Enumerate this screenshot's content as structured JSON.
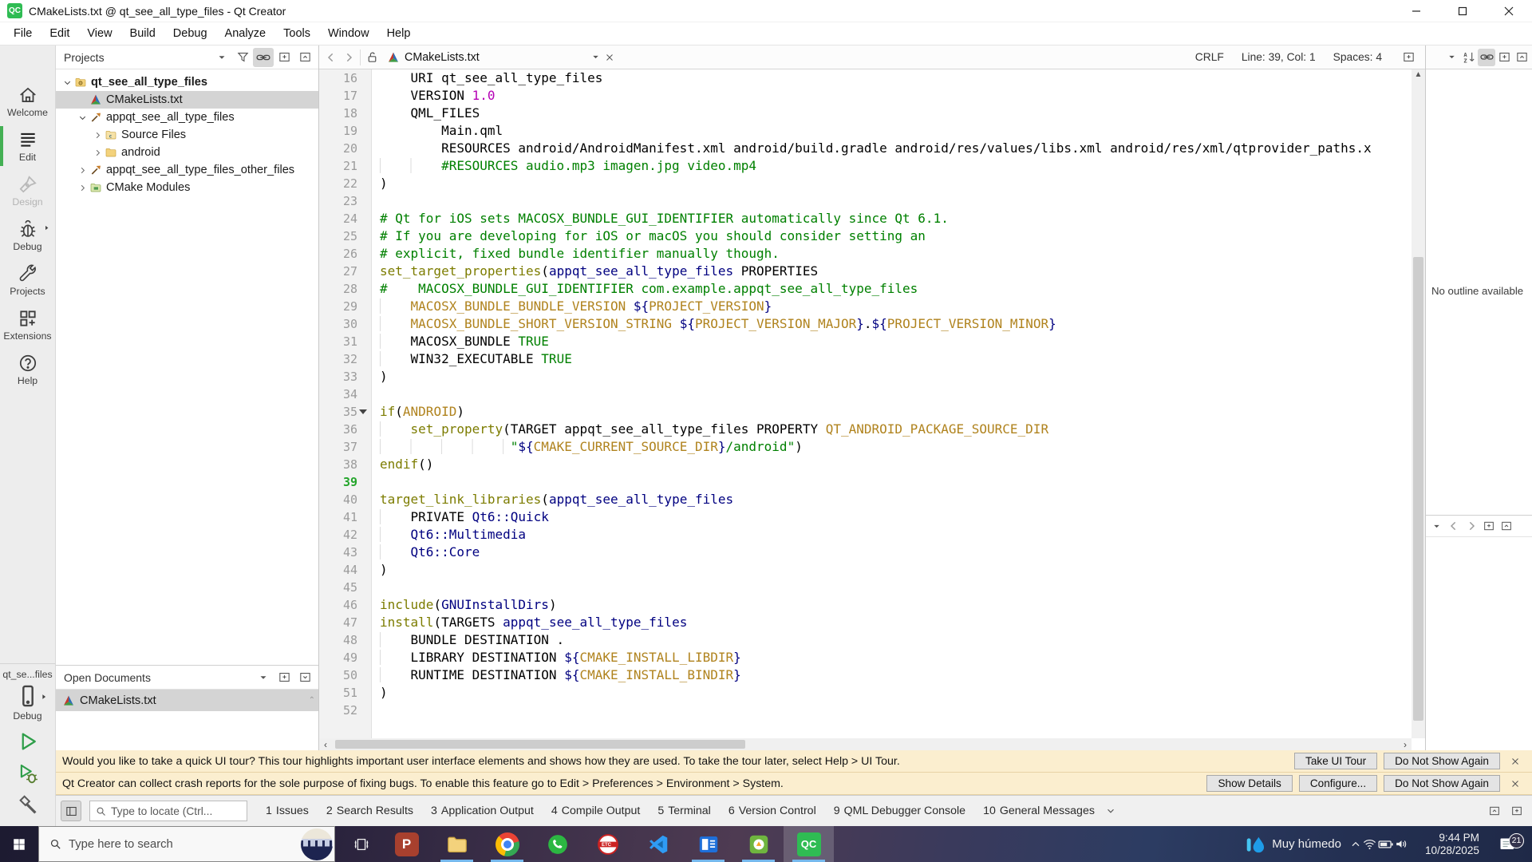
{
  "titlebar": {
    "title": "CMakeLists.txt @ qt_see_all_type_files - Qt Creator",
    "app_icon": "qt-creator-logo",
    "controls": [
      "minimize",
      "maximize",
      "close"
    ]
  },
  "menubar": {
    "items": [
      "File",
      "Edit",
      "View",
      "Build",
      "Debug",
      "Analyze",
      "Tools",
      "Window",
      "Help"
    ]
  },
  "modebar": {
    "modes": [
      {
        "label": "Welcome",
        "icon": "home-icon",
        "state": "normal"
      },
      {
        "label": "Edit",
        "icon": "edit-icon",
        "state": "active"
      },
      {
        "label": "Design",
        "icon": "design-icon",
        "state": "disabled"
      },
      {
        "label": "Debug",
        "icon": "debug-icon",
        "state": "normal",
        "context_arrow": true
      },
      {
        "label": "Projects",
        "icon": "wrench-icon",
        "state": "normal"
      },
      {
        "label": "Extensions",
        "icon": "extensions-icon",
        "state": "normal"
      },
      {
        "label": "Help",
        "icon": "help-icon",
        "state": "normal"
      }
    ],
    "kit": {
      "project": "qt_se...files",
      "device_icon": "phone-icon",
      "build_config": "Debug"
    },
    "run_buttons": [
      {
        "name": "run",
        "icon": "play-icon"
      },
      {
        "name": "debug-run",
        "icon": "play-debug-icon"
      },
      {
        "name": "build",
        "icon": "hammer-icon"
      }
    ]
  },
  "projects_panel": {
    "header": "Projects",
    "header_icons": [
      "combo-arrow",
      "filter-icon",
      "link-icon",
      "split-icon",
      "close-split-icon"
    ],
    "tree": [
      {
        "label": "qt_see_all_type_files",
        "icon": "project-folder",
        "depth": 0,
        "chevron": "expanded",
        "bold": true
      },
      {
        "label": "CMakeLists.txt",
        "icon": "cmake-file",
        "depth": 1,
        "chevron": "none",
        "selected": true
      },
      {
        "label": "appqt_see_all_type_files",
        "icon": "target",
        "depth": 1,
        "chevron": "expanded"
      },
      {
        "label": "Source Files",
        "icon": "source-folder",
        "depth": 2,
        "chevron": "collapsed"
      },
      {
        "label": "android",
        "icon": "folder",
        "depth": 2,
        "chevron": "collapsed"
      },
      {
        "label": "appqt_see_all_type_files_other_files",
        "icon": "target",
        "depth": 1,
        "chevron": "collapsed"
      },
      {
        "label": "CMake Modules",
        "icon": "modules-folder",
        "depth": 1,
        "chevron": "collapsed"
      }
    ],
    "open_documents": {
      "header": "Open Documents",
      "header_icons": [
        "combo-arrow",
        "split-icon",
        "close-split-down-icon"
      ],
      "items": [
        {
          "label": "CMakeLists.txt",
          "icon": "cmake-file",
          "selected": true
        }
      ]
    }
  },
  "editor": {
    "tab": {
      "file": "CMakeLists.txt",
      "icon": "cmake-file"
    },
    "status": {
      "line_ending": "CRLF",
      "cursor": "Line: 39, Col: 1",
      "spaces": "Spaces: 4"
    },
    "outline": "No outline available",
    "lines": [
      {
        "n": 16,
        "t": [
          [
            "    URI qt_see_all_type_files",
            "b"
          ]
        ]
      },
      {
        "n": 17,
        "t": [
          [
            "    VERSION ",
            "b"
          ],
          [
            "1.0",
            "m"
          ]
        ]
      },
      {
        "n": 18,
        "t": [
          [
            "    QML_FILES",
            "b"
          ]
        ]
      },
      {
        "n": 19,
        "t": [
          [
            "        Main.qml",
            "b"
          ]
        ]
      },
      {
        "n": 20,
        "t": [
          [
            "        RESOURCES android/AndroidManifest.xml android/build.gradle android/res/values/libs.xml android/res/xml/qtprovider_paths.x",
            "b"
          ]
        ]
      },
      {
        "n": 21,
        "t": [
          [
            "        ",
            "i"
          ],
          [
            "#RESOURCES audio.mp3 imagen.jpg video.mp4",
            "c"
          ]
        ]
      },
      {
        "n": 22,
        "t": [
          [
            ")",
            "b"
          ]
        ]
      },
      {
        "n": 23,
        "t": []
      },
      {
        "n": 24,
        "t": [
          [
            "# Qt for iOS sets MACOSX_BUNDLE_GUI_IDENTIFIER automatically since Qt 6.1.",
            "c"
          ]
        ]
      },
      {
        "n": 25,
        "t": [
          [
            "# If you are developing for iOS or macOS you should consider setting an",
            "c"
          ]
        ]
      },
      {
        "n": 26,
        "t": [
          [
            "# explicit, fixed bundle identifier manually though.",
            "c"
          ]
        ]
      },
      {
        "n": 27,
        "t": [
          [
            "set_target_properties",
            "f"
          ],
          [
            "(",
            "b"
          ],
          [
            "appqt_see_all_type_files",
            "n"
          ],
          [
            " PROPERTIES",
            "b"
          ]
        ]
      },
      {
        "n": 28,
        "t": [
          [
            "#    MACOSX_BUNDLE_GUI_IDENTIFIER com.example.appqt_see_all_type_files",
            "c"
          ]
        ]
      },
      {
        "n": 29,
        "t": [
          [
            "    ",
            "i"
          ],
          [
            "MACOSX_BUNDLE_BUNDLE_VERSION ",
            "v"
          ],
          [
            "${",
            "n"
          ],
          [
            "PROJECT_VERSION",
            "v"
          ],
          [
            "}",
            "n"
          ]
        ]
      },
      {
        "n": 30,
        "t": [
          [
            "    ",
            "i"
          ],
          [
            "MACOSX_BUNDLE_SHORT_VERSION_STRING ",
            "v"
          ],
          [
            "${",
            "n"
          ],
          [
            "PROJECT_VERSION_MAJOR",
            "v"
          ],
          [
            "}",
            "n"
          ],
          [
            ".",
            "b"
          ],
          [
            "${",
            "n"
          ],
          [
            "PROJECT_VERSION_MINOR",
            "v"
          ],
          [
            "}",
            "n"
          ]
        ]
      },
      {
        "n": 31,
        "t": [
          [
            "    ",
            "i"
          ],
          [
            "MACOSX_BUNDLE ",
            "b"
          ],
          [
            "TRUE",
            "g"
          ]
        ]
      },
      {
        "n": 32,
        "t": [
          [
            "    ",
            "i"
          ],
          [
            "WIN32_EXECUTABLE ",
            "b"
          ],
          [
            "TRUE",
            "g"
          ]
        ]
      },
      {
        "n": 33,
        "t": [
          [
            ")",
            "b"
          ]
        ]
      },
      {
        "n": 34,
        "t": []
      },
      {
        "n": 35,
        "fold": true,
        "t": [
          [
            "if",
            "f"
          ],
          [
            "(",
            "b"
          ],
          [
            "ANDROID",
            "v"
          ],
          [
            ")",
            "b"
          ]
        ]
      },
      {
        "n": 36,
        "t": [
          [
            "    ",
            "i"
          ],
          [
            "set_property",
            "f"
          ],
          [
            "(",
            "b"
          ],
          [
            "TARGET appqt_see_all_type_files PROPERTY ",
            "b"
          ],
          [
            "QT_ANDROID_PACKAGE_SOURCE_DIR",
            "v"
          ]
        ]
      },
      {
        "n": 37,
        "t": [
          [
            "                 ",
            "i"
          ],
          [
            "\"",
            "g"
          ],
          [
            "${",
            "n"
          ],
          [
            "CMAKE_CURRENT_SOURCE_DIR",
            "v"
          ],
          [
            "}",
            "n"
          ],
          [
            "/android\"",
            "g"
          ],
          [
            ")",
            "b"
          ]
        ]
      },
      {
        "n": 38,
        "t": [
          [
            "endif",
            "f"
          ],
          [
            "()",
            "b"
          ]
        ]
      },
      {
        "n": 39,
        "cur": true,
        "t": []
      },
      {
        "n": 40,
        "t": [
          [
            "target_link_libraries",
            "f"
          ],
          [
            "(",
            "b"
          ],
          [
            "appqt_see_all_type_files",
            "n"
          ]
        ]
      },
      {
        "n": 41,
        "t": [
          [
            "    ",
            "i"
          ],
          [
            "PRIVATE ",
            "b"
          ],
          [
            "Qt6::Quick",
            "n"
          ]
        ]
      },
      {
        "n": 42,
        "t": [
          [
            "    ",
            "i"
          ],
          [
            "Qt6::Multimedia",
            "n"
          ]
        ]
      },
      {
        "n": 43,
        "t": [
          [
            "    ",
            "i"
          ],
          [
            "Qt6::Core",
            "n"
          ]
        ]
      },
      {
        "n": 44,
        "t": [
          [
            ")",
            "b"
          ]
        ]
      },
      {
        "n": 45,
        "t": []
      },
      {
        "n": 46,
        "t": [
          [
            "include",
            "f"
          ],
          [
            "(",
            "b"
          ],
          [
            "GNUInstallDirs",
            "n"
          ],
          [
            ")",
            "b"
          ]
        ]
      },
      {
        "n": 47,
        "t": [
          [
            "install",
            "f"
          ],
          [
            "(",
            "b"
          ],
          [
            "TARGETS ",
            "b"
          ],
          [
            "appqt_see_all_type_files",
            "n"
          ]
        ]
      },
      {
        "n": 48,
        "t": [
          [
            "    ",
            "i"
          ],
          [
            "BUNDLE DESTINATION .",
            "b"
          ]
        ]
      },
      {
        "n": 49,
        "t": [
          [
            "    ",
            "i"
          ],
          [
            "LIBRARY DESTINATION ",
            "b"
          ],
          [
            "${",
            "n"
          ],
          [
            "CMAKE_INSTALL_LIBDIR",
            "v"
          ],
          [
            "}",
            "n"
          ]
        ]
      },
      {
        "n": 50,
        "t": [
          [
            "    ",
            "i"
          ],
          [
            "RUNTIME DESTINATION ",
            "b"
          ],
          [
            "${",
            "n"
          ],
          [
            "CMAKE_INSTALL_BINDIR",
            "v"
          ],
          [
            "}",
            "n"
          ]
        ]
      },
      {
        "n": 51,
        "t": [
          [
            ")",
            "b"
          ]
        ]
      },
      {
        "n": 52,
        "t": []
      }
    ],
    "toolbar_right_icons": [
      "combo-arrow",
      "sort-icon",
      "link-icon",
      "split-icon",
      "close-split-icon"
    ],
    "rp_bottom_icons": [
      "combo-arrow",
      "back-icon",
      "forward-icon",
      "split-icon",
      "close-split-icon"
    ]
  },
  "notifications": [
    {
      "text": "Would you like to take a quick UI tour? This tour highlights important user interface elements and shows how they are used. To take the tour later, select Help > UI Tour.",
      "buttons": [
        "Take UI Tour",
        "Do Not Show Again"
      ]
    },
    {
      "text": "Qt Creator can collect crash reports for the sole purpose of fixing bugs. To enable this feature go to Edit > Preferences > Environment > System.",
      "buttons": [
        "Show Details",
        "Configure...",
        "Do Not Show Again"
      ]
    }
  ],
  "statusbar": {
    "locator_placeholder": "Type to locate (Ctrl...",
    "panes": [
      [
        "1",
        "Issues"
      ],
      [
        "2",
        "Search Results"
      ],
      [
        "3",
        "Application Output"
      ],
      [
        "4",
        "Compile Output"
      ],
      [
        "5",
        "Terminal"
      ],
      [
        "6",
        "Version Control"
      ],
      [
        "9",
        "QML Debugger Console"
      ],
      [
        "10",
        "General Messages"
      ]
    ]
  },
  "taskbar": {
    "search_placeholder": "Type here to search",
    "apps": [
      {
        "name": "app-p",
        "running": false
      },
      {
        "name": "file-explorer",
        "running": true
      },
      {
        "name": "chrome",
        "running": true
      },
      {
        "name": "whatsapp",
        "running": false
      },
      {
        "name": "etc-app",
        "running": false
      },
      {
        "name": "vscode",
        "running": false
      },
      {
        "name": "blue-window-app",
        "running": true
      },
      {
        "name": "picpick",
        "running": true
      },
      {
        "name": "qt-creator",
        "running": true,
        "active": true
      }
    ],
    "tray": {
      "weather": "Muy húmedo",
      "time": "9:44 PM",
      "date": "10/28/2025",
      "badge": "21"
    }
  },
  "colors": {
    "accent_green": "#2fbc53",
    "selection": "#d4d4d4",
    "notification_bg": "#fbeecf",
    "code_func": "#7c7c00",
    "code_comment": "#008000",
    "code_var": "#b0831e",
    "code_navy": "#000080",
    "code_magenta": "#b500b5",
    "running_indicator": "#76b9ed"
  }
}
